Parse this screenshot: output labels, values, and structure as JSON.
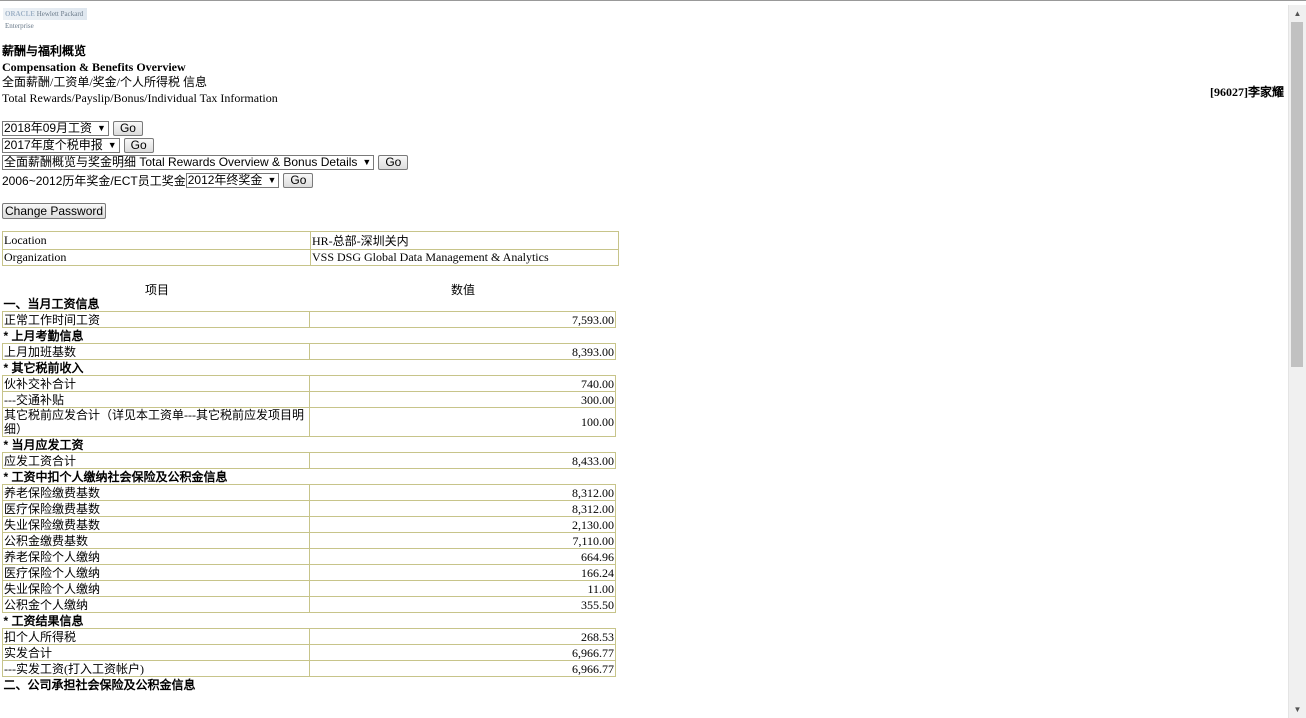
{
  "logo": {
    "brand": "ORACLE",
    "sub": "Hewlett Packard Enterprise"
  },
  "titles": {
    "cn_title": "薪酬与福利概览",
    "en_title": "Compensation & Benefits Overview",
    "cn_sub": "全面薪酬/工资单/奖金/个人所得税 信息",
    "en_sub": "Total Rewards/Payslip/Bonus/Individual Tax Information"
  },
  "employee": "[96027]李家耀",
  "forms": {
    "payroll_select": "2018年09月工资",
    "tax_select": "2017年度个税申报",
    "rewards_select": "全面薪酬概览与奖金明细 Total Rewards Overview & Bonus Details",
    "bonus_prefix": "2006~2012历年奖金/ECT员工奖金",
    "bonus_select": "2012年终奖金",
    "go": "Go"
  },
  "change_password": "Change Password",
  "info": {
    "location_label": "Location",
    "location_value": "HR-总部-深圳关内",
    "org_label": "Organization",
    "org_value": "VSS DSG Global Data Management & Analytics"
  },
  "table_header": {
    "item": "项目",
    "value": "数值"
  },
  "rows": [
    {
      "type": "sec",
      "label": "一、当月工资信息"
    },
    {
      "type": "row",
      "label": "正常工作时间工资",
      "value": "7,593.00"
    },
    {
      "type": "sec",
      "label": "* 上月考勤信息"
    },
    {
      "type": "row",
      "label": "上月加班基数",
      "value": "8,393.00"
    },
    {
      "type": "sec",
      "label": "* 其它税前收入"
    },
    {
      "type": "row",
      "label": "伙补交补合计",
      "value": "740.00"
    },
    {
      "type": "row",
      "label": "---交通补贴",
      "value": "300.00"
    },
    {
      "type": "row",
      "label": "其它税前应发合计（详见本工资单---其它税前应发项目明细）",
      "value": "100.00"
    },
    {
      "type": "sec",
      "label": "* 当月应发工资"
    },
    {
      "type": "row",
      "label": "应发工资合计",
      "value": "8,433.00"
    },
    {
      "type": "sec",
      "label": "* 工资中扣个人缴纳社会保险及公积金信息"
    },
    {
      "type": "row",
      "label": "养老保险缴费基数",
      "value": "8,312.00"
    },
    {
      "type": "row",
      "label": "医疗保险缴费基数",
      "value": "8,312.00"
    },
    {
      "type": "row",
      "label": "失业保险缴费基数",
      "value": "2,130.00"
    },
    {
      "type": "row",
      "label": "公积金缴费基数",
      "value": "7,110.00"
    },
    {
      "type": "row",
      "label": "养老保险个人缴纳",
      "value": "664.96"
    },
    {
      "type": "row",
      "label": "医疗保险个人缴纳",
      "value": "166.24"
    },
    {
      "type": "row",
      "label": "失业保险个人缴纳",
      "value": "11.00"
    },
    {
      "type": "row",
      "label": "公积金个人缴纳",
      "value": "355.50"
    },
    {
      "type": "sec",
      "label": "* 工资结果信息"
    },
    {
      "type": "row",
      "label": "扣个人所得税",
      "value": "268.53"
    },
    {
      "type": "row",
      "label": "实发合计",
      "value": "6,966.77"
    },
    {
      "type": "row",
      "label": "---实发工资(打入工资帐户)",
      "value": "6,966.77"
    },
    {
      "type": "sec",
      "label": "二、公司承担社会保险及公积金信息"
    }
  ]
}
